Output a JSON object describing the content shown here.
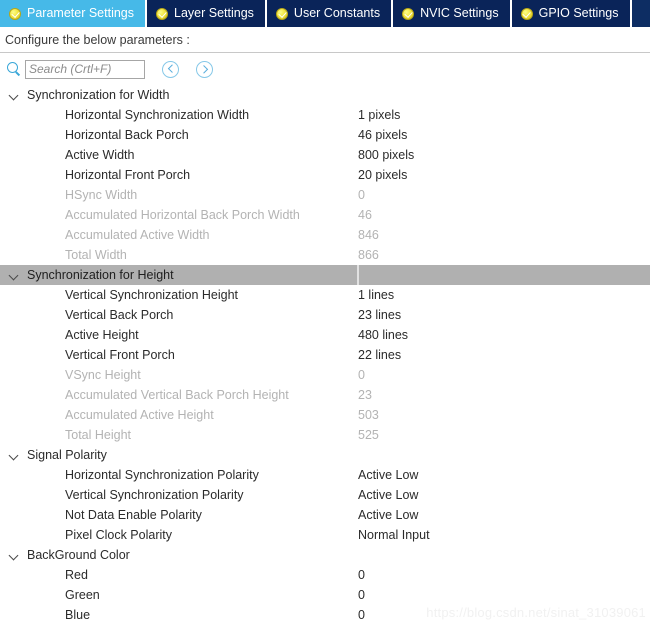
{
  "tabs": [
    {
      "label": "Parameter Settings",
      "icon": "check-circle-icon",
      "active": true
    },
    {
      "label": "Layer Settings",
      "icon": "check-circle-icon",
      "active": false
    },
    {
      "label": "User Constants",
      "icon": "check-circle-icon",
      "active": false
    },
    {
      "label": "NVIC Settings",
      "icon": "check-circle-icon",
      "active": false
    },
    {
      "label": "GPIO Settings",
      "icon": "check-circle-icon",
      "active": false
    }
  ],
  "subheader": {
    "text": "Configure the below parameters :"
  },
  "search": {
    "placeholder": "Search (Crtl+F)",
    "value": "",
    "icon": "search-icon",
    "prev_icon": "chevron-left-circle-icon",
    "next_icon": "chevron-right-circle-icon"
  },
  "colors": {
    "tab_active_bg": "#46b9e8",
    "tab_inactive_bg": "#0a2459",
    "tab_icon": "#f2e642",
    "selected_row_bg": "#b0b0b0",
    "disabled_text": "#b3b3b3",
    "normal_text": "#2b2b2b",
    "accent": "#3aa7d8"
  },
  "groups": [
    {
      "title": "Synchronization for Width",
      "expanded": true,
      "selected": false,
      "rows": [
        {
          "label": "Horizontal Synchronization Width",
          "value": "1 pixels",
          "disabled": false
        },
        {
          "label": "Horizontal Back Porch",
          "value": "46 pixels",
          "disabled": false
        },
        {
          "label": "Active Width",
          "value": "800 pixels",
          "disabled": false
        },
        {
          "label": "Horizontal Front Porch",
          "value": "20 pixels",
          "disabled": false
        },
        {
          "label": "HSync Width",
          "value": "0",
          "disabled": true
        },
        {
          "label": "Accumulated Horizontal Back Porch Width",
          "value": "46",
          "disabled": true
        },
        {
          "label": "Accumulated Active Width",
          "value": "846",
          "disabled": true
        },
        {
          "label": "Total Width",
          "value": "866",
          "disabled": true
        }
      ]
    },
    {
      "title": "Synchronization for Height",
      "expanded": true,
      "selected": true,
      "rows": [
        {
          "label": "Vertical Synchronization Height",
          "value": "1 lines",
          "disabled": false
        },
        {
          "label": "Vertical Back Porch",
          "value": "23 lines",
          "disabled": false
        },
        {
          "label": "Active Height",
          "value": "480 lines",
          "disabled": false
        },
        {
          "label": "Vertical Front Porch",
          "value": "22 lines",
          "disabled": false
        },
        {
          "label": "VSync Height",
          "value": "0",
          "disabled": true
        },
        {
          "label": "Accumulated Vertical Back Porch Height",
          "value": "23",
          "disabled": true
        },
        {
          "label": "Accumulated Active Height",
          "value": "503",
          "disabled": true
        },
        {
          "label": "Total Height",
          "value": "525",
          "disabled": true
        }
      ]
    },
    {
      "title": "Signal Polarity",
      "expanded": true,
      "selected": false,
      "rows": [
        {
          "label": "Horizontal Synchronization Polarity",
          "value": "Active Low",
          "disabled": false
        },
        {
          "label": "Vertical Synchronization Polarity",
          "value": "Active Low",
          "disabled": false
        },
        {
          "label": "Not Data Enable Polarity",
          "value": "Active Low",
          "disabled": false
        },
        {
          "label": "Pixel Clock Polarity",
          "value": "Normal Input",
          "disabled": false
        }
      ]
    },
    {
      "title": "BackGround Color",
      "expanded": true,
      "selected": false,
      "rows": [
        {
          "label": "Red",
          "value": "0",
          "disabled": false
        },
        {
          "label": "Green",
          "value": "0",
          "disabled": false
        },
        {
          "label": "Blue",
          "value": "0",
          "disabled": false
        }
      ]
    }
  ],
  "watermark": {
    "text": "https://blog.csdn.net/sinat_31039061"
  }
}
